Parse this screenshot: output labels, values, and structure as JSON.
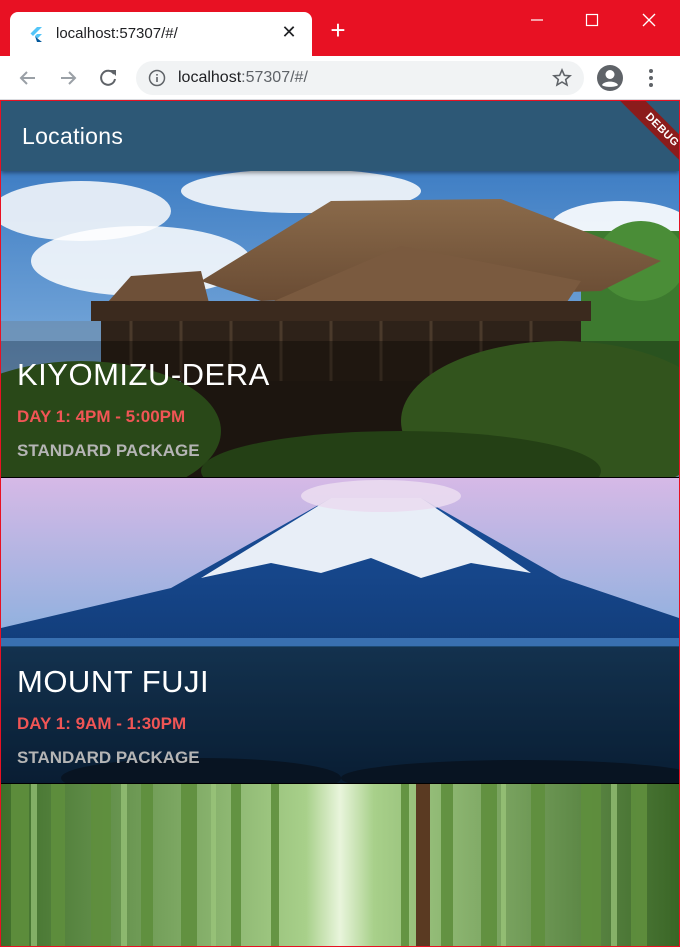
{
  "browser": {
    "tab_title": "localhost:57307/#/",
    "new_tab_label": "+",
    "url_host": "localhost",
    "url_rest": ":57307/#/"
  },
  "app": {
    "title": "Locations",
    "debug_label": "DEBUG"
  },
  "locations": [
    {
      "name": "KIYOMIZU-DERA",
      "time": "DAY 1: 4PM - 5:00PM",
      "package": "STANDARD PACKAGE",
      "image": "temple-photo"
    },
    {
      "name": "MOUNT FUJI",
      "time": "DAY 1: 9AM - 1:30PM",
      "package": "STANDARD PACKAGE",
      "image": "mountain-photo"
    },
    {
      "image": "bamboo-forest-photo"
    }
  ],
  "colors": {
    "chrome_frame": "#e81123",
    "app_bar": "#2d5876",
    "time_text": "#f05555",
    "package_text": "#b5b5b5"
  }
}
